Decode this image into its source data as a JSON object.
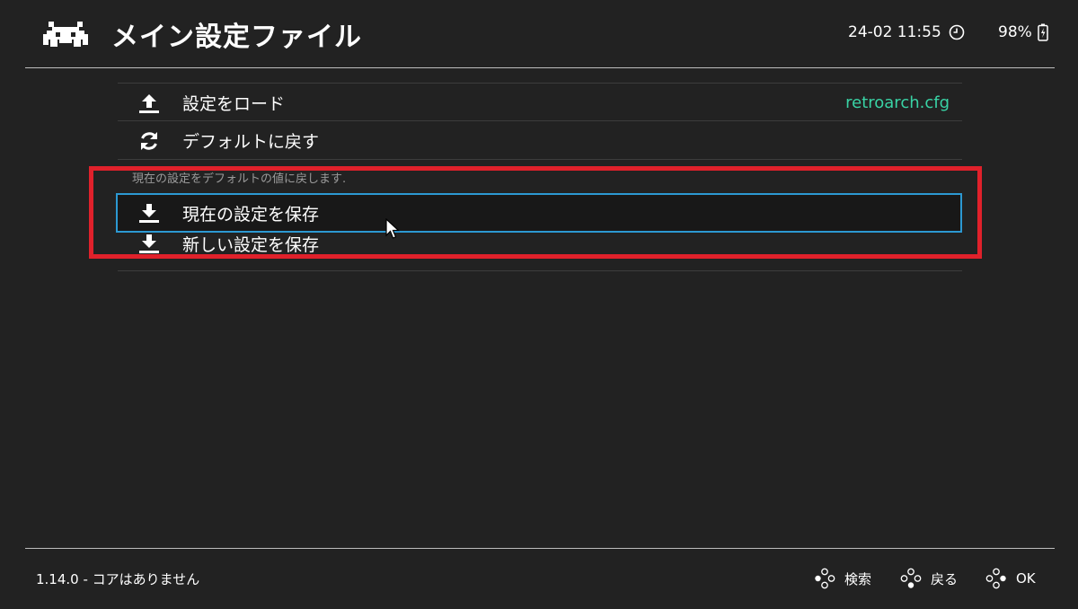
{
  "header": {
    "title": "メイン設定ファイル",
    "clock": "24-02 11:55",
    "battery": "98%",
    "logo_icon": "retroarch-invader-icon"
  },
  "menu": {
    "items": [
      {
        "label": "設定をロード",
        "value": "retroarch.cfg",
        "icon": "upload-icon"
      },
      {
        "label": "デフォルトに戻す",
        "icon": "refresh-icon"
      },
      {
        "label": "現在の設定を保存",
        "icon": "download-icon",
        "selected": true
      },
      {
        "label": "新しい設定を保存",
        "icon": "download-icon"
      }
    ],
    "sublabel": "現在の設定をデフォルトの値に戻します."
  },
  "footer": {
    "status": "1.14.0 - コアはありません",
    "hints": [
      {
        "label": "検索",
        "icon": "gamepad-buttons-icon"
      },
      {
        "label": "戻る",
        "icon": "gamepad-buttons-icon"
      },
      {
        "label": "OK",
        "icon": "gamepad-buttons-icon"
      }
    ]
  },
  "colors": {
    "background": "#222222",
    "value_accent": "#39d3a5",
    "selection_border": "#2c99d2",
    "annotation": "#e0212b"
  }
}
